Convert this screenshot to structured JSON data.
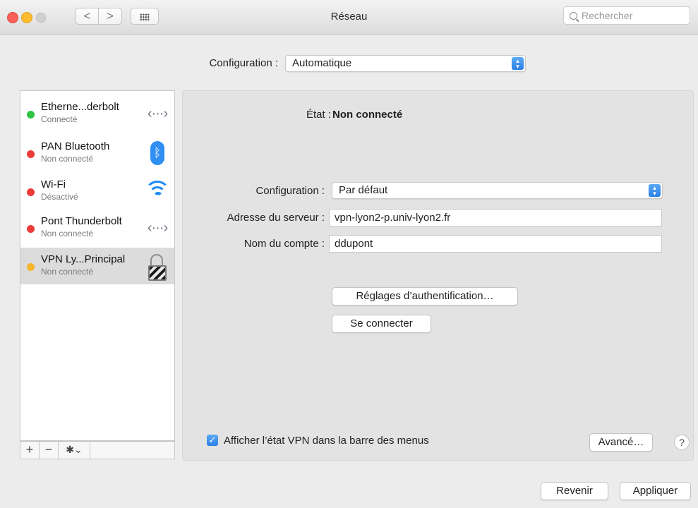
{
  "window": {
    "title": "Réseau",
    "search_placeholder": "Rechercher",
    "back_glyph": "<",
    "forward_glyph": ">"
  },
  "location": {
    "label": "Configuration :",
    "value": "Automatique"
  },
  "services": [
    {
      "name": "Etherne...derbolt",
      "status": "Connecté",
      "status_color": "#2fc443",
      "icon": "ethernet-icon"
    },
    {
      "name": "PAN Bluetooth",
      "status": "Non connecté",
      "status_color": "#ec3b38",
      "icon": "bluetooth-icon"
    },
    {
      "name": "Wi-Fi",
      "status": "Désactivé",
      "status_color": "#ec3b38",
      "icon": "wifi-icon"
    },
    {
      "name": "Pont Thunderbolt",
      "status": "Non connecté",
      "status_color": "#ec3b38",
      "icon": "ethernet-icon"
    },
    {
      "name": "VPN Ly...Principal",
      "status": "Non connecté",
      "status_color": "#f7b52c",
      "icon": "lock-icon",
      "selected": true
    }
  ],
  "sidebar_tools": {
    "add": "+",
    "remove": "−",
    "gear": "✱⌄"
  },
  "detail": {
    "state_label": "État :",
    "state_value": "Non connecté",
    "config_label": "Configuration :",
    "config_value": "Par défaut",
    "server_label": "Adresse du serveur :",
    "server_value": "vpn-lyon2-p.univ-lyon2.fr",
    "account_label": "Nom du compte :",
    "account_value": "ddupont",
    "auth_button": "Réglages d’authentification…",
    "connect_button": "Se connecter",
    "show_vpn_checkbox": "Afficher l’état VPN dans la barre des menus",
    "show_vpn_checked": true,
    "advanced_button": "Avancé…",
    "help_button": "?"
  },
  "footer": {
    "revert_button": "Revenir",
    "apply_button": "Appliquer"
  },
  "colors": {
    "accent": "#2b7fe6"
  }
}
